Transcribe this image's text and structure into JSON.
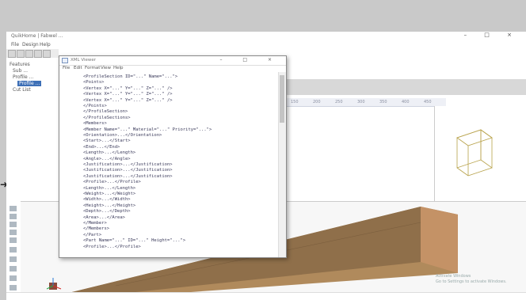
{
  "app": {
    "title": "QuikHome | Fabwel ... ",
    "window_controls": "– □ ×",
    "menu": [
      "File",
      "Design",
      "Help"
    ],
    "tree": [
      "Features",
      "Sub ...",
      "Profile ...",
      "Profile ...",
      "Cut List"
    ],
    "ruler_ticks": [
      "100",
      "150",
      "200",
      "250",
      "300",
      "350",
      "400",
      "450"
    ],
    "status_left": "",
    "status_right": "",
    "watermark": [
      "Activate Windows",
      "Go to Settings to activate Windows."
    ]
  },
  "xml_viewer": {
    "title": "XML Viewer",
    "window_controls": "–  □  ×",
    "menu": [
      "File",
      "Edit",
      "Format",
      "View",
      "Help"
    ],
    "lines": [
      "<ProfileSection ID=\"...\" Name=\"...\">",
      "  <Points>",
      "    <Vertex X=\"...\" Y=\"...\" Z=\"...\" />",
      "    <Vertex X=\"...\" Y=\"...\" Z=\"...\" />",
      "    <Vertex X=\"...\" Y=\"...\" Z=\"...\" />",
      "  </Points>",
      "</ProfileSection>",
      "</ProfileSections>",
      "<Members>",
      "  <Member Name=\"...\" Material=\"...\" Priority=\"...\">",
      "    <Orientation>...</Orientation>",
      "    <Start>...</Start>",
      "    <End>...</End>",
      "    <Length>...</Length>",
      "    <Angle>...</Angle>",
      "    <Justification>...</Justification>",
      "    <Justification>...</Justification>",
      "    <Justification>...</Justification>",
      "    <Profile>...</Profile>",
      "    <Length>...</Length>",
      "    <Weight>...</Weight>",
      "    <Width>...</Width>",
      "    <Height>...</Height>",
      "    <Depth>...</Depth>",
      "    <Area>...</Area>",
      "  </Member>",
      "</Members>",
      "</Part>",
      "<Part Name=\"...\" ID=\"...\" Height=\"...\">",
      "  <Profile>...</Profile>"
    ]
  }
}
